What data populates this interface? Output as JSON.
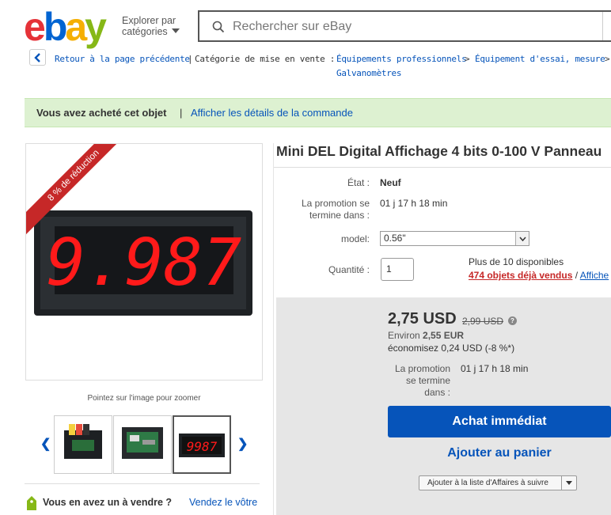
{
  "header": {
    "logo": [
      "e",
      "b",
      "a",
      "y"
    ],
    "explore_line1": "Explorer par",
    "explore_line2": "catégories",
    "search_placeholder": "Rechercher sur eBay"
  },
  "breadcrumb": {
    "back_label": "Retour à la page précédente",
    "separator": "|",
    "category_label": "Catégorie de mise en vente :",
    "items": [
      "Équipements professionnels",
      "Équipement d'essai, mesure",
      "Galvanomètres"
    ],
    "arrow": ">"
  },
  "banner": {
    "bought": "Vous avez acheté cet objet",
    "separator": "|",
    "details_link": "Afficher les détails de la commande"
  },
  "gallery": {
    "discount_ribbon": "8 % de réduction",
    "display_digits": "9.987",
    "zoom_tip": "Pointez sur l'image pour zoomer",
    "thumb_digits": "9987",
    "selected_thumb": 3
  },
  "sell": {
    "question": "Vous en avez un à vendre ?",
    "link": "Vendez le vôtre"
  },
  "item": {
    "title": "Mini DEL Digital Affichage 4 bits 0-100 V Panneau",
    "condition_label": "État :",
    "condition_value": "Neuf",
    "promo_label_1": "La promotion se",
    "promo_label_2": "termine dans :",
    "promo_value": "01 j 17 h 18 min",
    "model_label": "model:",
    "model_value": "0.56\"",
    "qty_label": "Quantité :",
    "qty_value": "1",
    "available": "Plus de 10 disponibles",
    "sold": "474 objets déjà vendus",
    "sold_sep": "/",
    "sold_link": "Affiche"
  },
  "buybox": {
    "price": "2,75 USD",
    "old_price": "2,99 USD",
    "help_icon": "?",
    "approx_prefix": "Environ",
    "approx_value": "2,55 EUR",
    "savings": "économisez 0,24 USD (-8 %*)",
    "promo_label_1": "La promotion",
    "promo_label_2": "se termine",
    "promo_label_3": "dans :",
    "promo_value": "01 j 17 h 18 min",
    "buy_now": "Achat immédiat",
    "add_to_cart": "Ajouter au panier",
    "watch": "Ajouter à la liste d'Affaires à suivre"
  },
  "colors": {
    "link": "#0654ba",
    "banner_bg": "#ddf1d1",
    "ribbon": "#c62828",
    "buy_button": "#0654ba",
    "led": "#ff1a1a"
  }
}
